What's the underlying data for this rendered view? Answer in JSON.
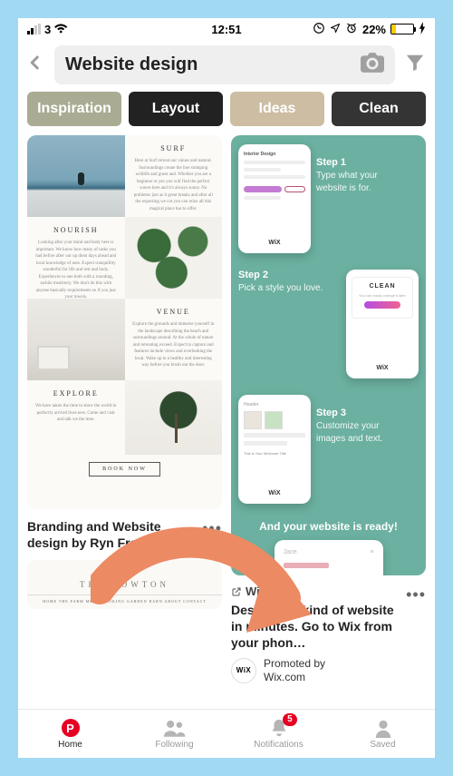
{
  "status": {
    "carrier_signal": "3",
    "time": "12:51",
    "battery_pct": "22%"
  },
  "search": {
    "query": "Website design"
  },
  "filters": {
    "a": "Inspiration",
    "b": "Layout",
    "c": "Ideas",
    "d": "Clean"
  },
  "pin1": {
    "surf_h": "SURF",
    "nourish_h": "NOURISH",
    "venue_h": "VENUE",
    "explore_h": "EXPLORE",
    "book": "BOOK NOW",
    "title": "Branding and Website design by Ryn Frank…"
  },
  "pin2": {
    "step1_h": "Step 1",
    "step1_t": "Type what your website is for.",
    "step2_h": "Step 2",
    "step2_t": "Pick a style you love.",
    "step3_h": "Step 3",
    "step3_t": "Customize your images and text.",
    "clean_label": "CLEAN",
    "wix_label": "WiX",
    "ready": "And your website is ready!",
    "ready_name": "Jane.",
    "link": "Wix.com",
    "title": "Design any kind of website in minutes. Go to Wix from your phon…",
    "promo_a": "Promoted by",
    "promo_b": "Wix.com",
    "badge": "WiX"
  },
  "pin3": {
    "logo": "THE BOWTON",
    "nav": "HOME   THE FARM   MENU   BOOKING   GARDEN   BARN   ABOUT   CONTACT"
  },
  "tabs": {
    "home": "Home",
    "following": "Following",
    "notifications": "Notifications",
    "saved": "Saved",
    "badge": "5"
  }
}
